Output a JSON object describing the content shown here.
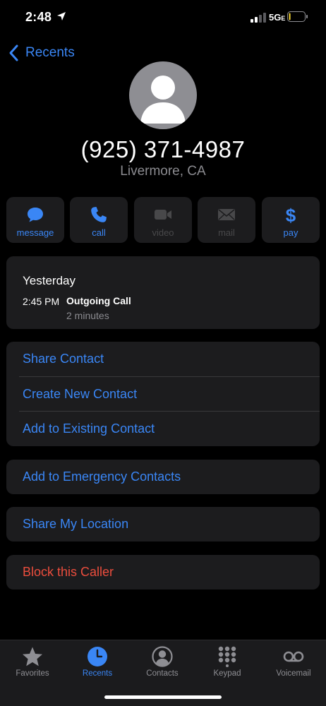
{
  "status_bar": {
    "time": "2:48",
    "network": "5G",
    "network_suffix": "E",
    "battery_level": 0.1,
    "battery_color": "#f5d433"
  },
  "nav": {
    "back_label": "Recents"
  },
  "contact": {
    "phone_number": "(925) 371-4987",
    "location": "Livermore, CA"
  },
  "actions": [
    {
      "label": "message",
      "icon": "message-bubble-icon",
      "enabled": true
    },
    {
      "label": "call",
      "icon": "phone-icon",
      "enabled": true
    },
    {
      "label": "video",
      "icon": "video-camera-icon",
      "enabled": false
    },
    {
      "label": "mail",
      "icon": "envelope-icon",
      "enabled": false
    },
    {
      "label": "pay",
      "icon": "dollar-icon",
      "enabled": true
    }
  ],
  "history": {
    "day": "Yesterday",
    "time": "2:45 PM",
    "type": "Outgoing Call",
    "duration": "2 minutes"
  },
  "options": {
    "share_contact": "Share Contact",
    "create_new_contact": "Create New Contact",
    "add_to_existing": "Add to Existing Contact",
    "add_to_emergency": "Add to Emergency Contacts",
    "share_location": "Share My Location",
    "block_caller": "Block this Caller"
  },
  "tabs": [
    {
      "label": "Favorites",
      "icon": "star-icon",
      "active": false
    },
    {
      "label": "Recents",
      "icon": "clock-icon",
      "active": true
    },
    {
      "label": "Contacts",
      "icon": "person-circle-icon",
      "active": false
    },
    {
      "label": "Keypad",
      "icon": "keypad-icon",
      "active": false
    },
    {
      "label": "Voicemail",
      "icon": "voicemail-icon",
      "active": false
    }
  ],
  "colors": {
    "accent": "#3a86f5",
    "destructive": "#eb4d3d",
    "card": "#1c1c1e",
    "secondary_text": "#8b8b90"
  }
}
